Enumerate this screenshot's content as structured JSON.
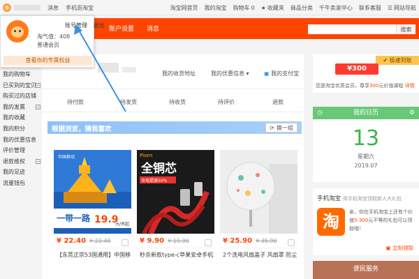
{
  "topbar": {
    "left": [
      "消息",
      "手机逛淘宝"
    ],
    "right": [
      "淘宝网首页",
      "我的淘宝",
      "购物车",
      "收藏夹",
      "商品分类",
      "千牛卖家中心",
      "联系客服",
      "网站导航"
    ],
    "cart_count": "0"
  },
  "header": {
    "nav1": "账户设置",
    "nav2": "消息",
    "search_placeholder": "",
    "search_button": "搜索"
  },
  "dropdown": {
    "taoqizhi": "淘气值：408",
    "member": "普通会员",
    "account_manage": "账号管理",
    "logout": "退出",
    "rights": "查看你的专属权益"
  },
  "sidebar": {
    "items": [
      "我的购物车",
      "已买到的宝贝",
      "购买过的店铺",
      "我的发票",
      "我的收藏",
      "我的积分",
      "我的优惠信息",
      "评价管理",
      "退款维权",
      "我的足迹",
      "流量钱包"
    ]
  },
  "profile": {
    "addr": "我的收货地址",
    "coupon": "我的优惠信息",
    "pay": "我的支付宝"
  },
  "orders": [
    "待付款",
    "待发货",
    "待收货",
    "待评价",
    "退款"
  ],
  "guess": {
    "title": "根据浏览，猜我喜欢",
    "refresh": "换一组"
  },
  "products": [
    {
      "price": "¥ 22.40",
      "old": "¥ 22.40",
      "title": "【东莞正宗53国通用】中国移动",
      "promo": "一带一路",
      "promo2": "19.9",
      "promo3": "元/天起",
      "carrier": "中国移动"
    },
    {
      "price": "¥ 9.90",
      "old": "¥ 19.90",
      "title": "秒杀新款type-c苹果安卓手机数据",
      "promo": "全铜芯",
      "promo2": "充电提速50%",
      "brand": "Pisen"
    },
    {
      "price": "¥ 25.90",
      "old": "¥ 35.90",
      "title": "2个洗电风扇盖子 风扇罩 防尘"
    }
  ],
  "right": {
    "promo_tag": "极速到账",
    "promo_coupon": "¥300",
    "promo_desc_1": "您是淘宝优质会员，尊享",
    "promo_desc_red": "300",
    "promo_desc_2": "元价值课程",
    "promo_desc_more": "详情",
    "calendar_title": "我的日历",
    "calendar_day": "13",
    "calendar_week": "星期六",
    "calendar_date": "2019.07",
    "mobile_title": "手机淘宝",
    "mobile_sub": "用手机淘宝领取新人大礼包",
    "mobile_tao": "淘",
    "mobile_desc_1": "亲，你在手机淘宝上还有个价值",
    "mobile_desc_red": "5-300",
    "mobile_desc_2": "元不等的礼包可以领取哦！",
    "mobile_go": "立刻领取",
    "service": "便民服务"
  }
}
